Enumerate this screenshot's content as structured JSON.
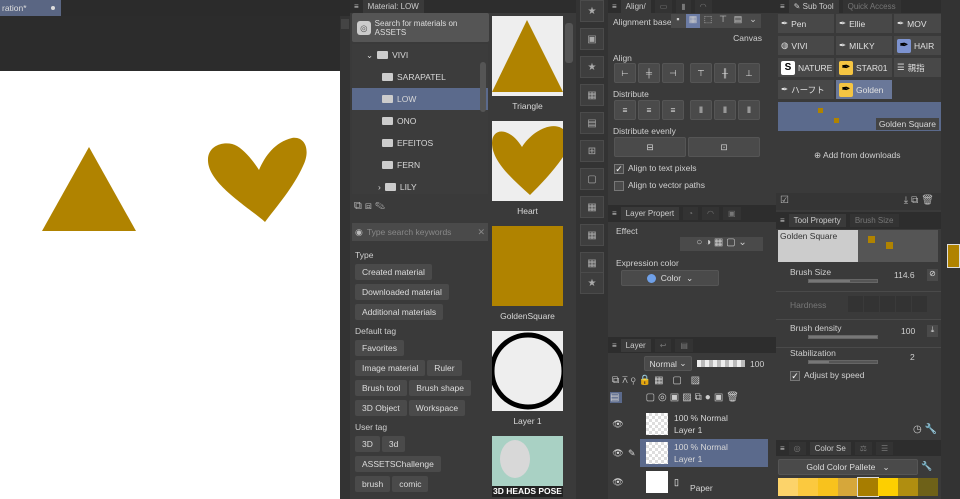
{
  "canvas": {
    "tab_label": "ration*"
  },
  "material": {
    "title": "Material: LOW",
    "assets_button": "Search for materials on ASSETS",
    "tree": [
      {
        "label": "VIVI",
        "expanded": true
      },
      {
        "label": "SARAPATEL"
      },
      {
        "label": "LOW",
        "selected": true
      },
      {
        "label": "ONO"
      },
      {
        "label": "EFEITOS"
      },
      {
        "label": "FERN"
      },
      {
        "label": "LILY",
        "collapsed": true
      }
    ],
    "search_placeholder": "Type search keywords",
    "type_heading": "Type",
    "type_tags": [
      "Created material",
      "Downloaded material",
      "Additional materials"
    ],
    "default_heading": "Default tag",
    "default_tags": [
      "Favorites",
      "Image material",
      "Ruler",
      "Brush tool",
      "Brush shape",
      "3D Object",
      "Workspace"
    ],
    "user_heading": "User tag",
    "user_tags": [
      "3D",
      "3d",
      "ASSETSChallenge",
      "brush",
      "comic"
    ],
    "items": [
      "Triangle",
      "Heart",
      "GoldenSquare",
      "Layer 1",
      "3D HEADS POSE"
    ]
  },
  "align": {
    "title": "Align/",
    "base_label": "Alignment base",
    "base_value": "Canvas",
    "align_label": "Align",
    "distribute_label": "Distribute",
    "even_label": "Distribute evenly",
    "opt1": "Align to text pixels",
    "opt1_checked": true,
    "opt2": "Align to vector paths",
    "opt2_checked": false
  },
  "layer_prop": {
    "title": "Layer Propert",
    "effect": "Effect",
    "expr_label": "Expression color",
    "expr_value": "Color"
  },
  "layer": {
    "title": "Layer",
    "blend": "Normal",
    "opacity": "100",
    "layers": [
      {
        "mode": "100 % Normal",
        "name": "Layer 1"
      },
      {
        "mode": "100 % Normal",
        "name": "Layer 1",
        "selected": true
      },
      {
        "mode": "",
        "name": "Paper"
      }
    ]
  },
  "subtool": {
    "title": "Sub Tool",
    "tab2": "Quick Access",
    "items": [
      {
        "label": "Pen",
        "icon": "pen"
      },
      {
        "label": "Ellie",
        "icon": "pen"
      },
      {
        "label": "MOV",
        "icon": "pen"
      },
      {
        "label": "VIVI",
        "icon": "blob"
      },
      {
        "label": "MILKY",
        "icon": "pen"
      },
      {
        "label": "HAIR",
        "icon": "pen"
      },
      {
        "label": "NATURE",
        "icon": "S"
      },
      {
        "label": "STAR01",
        "icon": "pen"
      },
      {
        "label": "親指",
        "icon": "lines"
      },
      {
        "label": "ハーフト",
        "icon": "pen"
      },
      {
        "label": "Golden",
        "icon": "pen",
        "selected": true
      }
    ],
    "preview_label": "Golden Square",
    "add_label": "Add from downloads"
  },
  "toolprop": {
    "title": "Tool Property",
    "tab2": "Brush Size",
    "preview_label": "Golden Square",
    "brush_size_label": "Brush Size",
    "brush_size": "114.6",
    "brush_size_fill": 0.6,
    "hardness_label": "Hardness",
    "density_label": "Brush density",
    "density": "100",
    "density_fill": 1.0,
    "stab_label": "Stabilization",
    "stab": "2",
    "stab_fill": 0.3,
    "adjust_label": "Adjust by speed",
    "adjust_checked": true
  },
  "colorset": {
    "title": "Color Se",
    "palette": "Gold Color Pallete",
    "colors": [
      "#fcd36a",
      "#fbc93f",
      "#f8c21d",
      "#d6a73a",
      "#a77d00",
      "#fdcf00",
      "#b08e10",
      "#6e6118"
    ]
  },
  "colors": {
    "gold": "#b08300",
    "selection": "#5b6a8c"
  }
}
